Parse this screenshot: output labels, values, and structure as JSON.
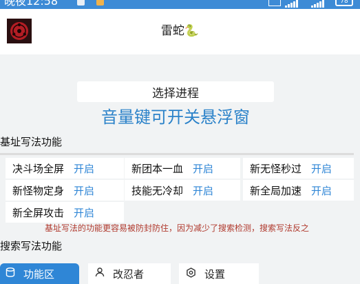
{
  "status_bar": {
    "time": "晚夜12:58",
    "battery": "78",
    "accent": "#3d8bd6"
  },
  "header": {
    "title": "雷蛇🐍"
  },
  "process_button": {
    "label": "选择进程"
  },
  "notice": "音量键可开关悬浮窗",
  "section_base": {
    "title": "基址写法功能",
    "features": [
      {
        "name": "决斗场全屏",
        "toggle": "开启"
      },
      {
        "name": "新团本一血",
        "toggle": "开启"
      },
      {
        "name": "新无怪秒过",
        "toggle": "开启"
      },
      {
        "name": "新怪物定身",
        "toggle": "开启"
      },
      {
        "name": "技能无冷却",
        "toggle": "开启"
      },
      {
        "name": "新全局加速",
        "toggle": "开启"
      },
      {
        "name": "新全屏攻击",
        "toggle": "开启"
      }
    ],
    "warning": "基址写法的功能更容易被防封防住，因为减少了搜索检测，搜索写法反之"
  },
  "section_search": {
    "title": "搜索写法功能"
  },
  "tabs": [
    {
      "label": "功能区",
      "icon": "database-icon",
      "active": true
    },
    {
      "label": "改忍者",
      "icon": "person-icon",
      "active": false
    },
    {
      "label": "设置",
      "icon": "settings-icon",
      "active": false
    }
  ],
  "colors": {
    "toggle": "#2f86d6",
    "notice": "#2b82c9",
    "warning": "#b03a2e",
    "active_tab": "#2f86d6"
  }
}
